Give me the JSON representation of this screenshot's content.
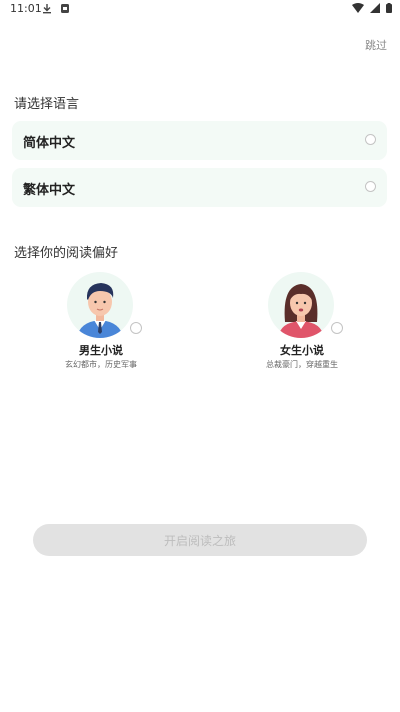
{
  "status_bar": {
    "time": "11:01"
  },
  "header": {
    "skip_label": "跳过"
  },
  "language_section": {
    "title": "请选择语言",
    "options": [
      {
        "label": "简体中文"
      },
      {
        "label": "繁体中文"
      }
    ]
  },
  "preference_section": {
    "title": "选择你的阅读偏好",
    "options": [
      {
        "label": "男生小说",
        "desc": "玄幻都市，历史军事"
      },
      {
        "label": "女生小说",
        "desc": "总裁豪门，穿越重生"
      }
    ]
  },
  "start_button": {
    "label": "开启阅读之旅"
  },
  "colors": {
    "card_bg": "#f3faf6",
    "button_bg": "#e2e2e2",
    "button_text": "#bdbdbd"
  }
}
